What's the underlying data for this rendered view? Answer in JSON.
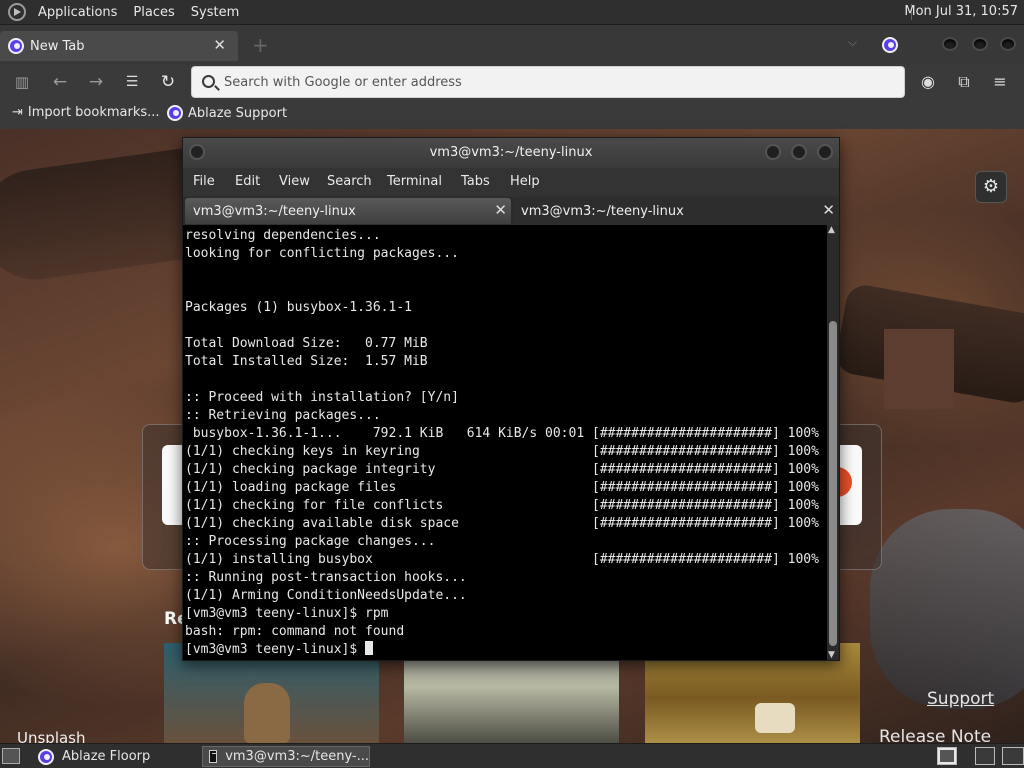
{
  "panel": {
    "menus": [
      "Applications",
      "Places",
      "System"
    ],
    "clock": "Mon Jul 31, 10:57"
  },
  "browser": {
    "tab": {
      "title": "New Tab",
      "close": "✕"
    },
    "urlbar": {
      "placeholder": "Search with Google or enter address"
    },
    "bookmarks": [
      {
        "label": "Import bookmarks...",
        "icon": "import-icon"
      },
      {
        "label": "Ablaze Support",
        "icon": "floorp-icon"
      }
    ]
  },
  "newtab": {
    "recommended_heading": "Re",
    "links": {
      "unsplash": "Unsplash",
      "support": "Support",
      "release": "Release Note"
    }
  },
  "terminal": {
    "title": "vm3@vm3:~/teeny-linux",
    "menus": [
      "File",
      "Edit",
      "View",
      "Search",
      "Terminal",
      "Tabs",
      "Help"
    ],
    "tabs": [
      {
        "label": "vm3@vm3:~/teeny-linux",
        "active": true
      },
      {
        "label": "vm3@vm3:~/teeny-linux",
        "active": false
      }
    ],
    "lines": [
      "resolving dependencies...",
      "looking for conflicting packages...",
      "",
      "",
      "Packages (1) busybox-1.36.1-1",
      "",
      "Total Download Size:   0.77 MiB",
      "Total Installed Size:  1.57 MiB",
      "",
      ":: Proceed with installation? [Y/n]",
      ":: Retrieving packages...",
      " busybox-1.36.1-1...    792.1 KiB   614 KiB/s 00:01 [######################] 100%",
      "(1/1) checking keys in keyring                      [######################] 100%",
      "(1/1) checking package integrity                    [######################] 100%",
      "(1/1) loading package files                         [######################] 100%",
      "(1/1) checking for file conflicts                   [######################] 100%",
      "(1/1) checking available disk space                 [######################] 100%",
      ":: Processing package changes...",
      "(1/1) installing busybox                            [######################] 100%",
      ":: Running post-transaction hooks...",
      "(1/1) Arming ConditionNeedsUpdate...",
      "[vm3@vm3 teeny-linux]$ rpm",
      "bash: rpm: command not found",
      "[vm3@vm3 teeny-linux]$ "
    ]
  },
  "taskbar": {
    "tasks": [
      "Ablaze Floorp",
      "vm3@vm3:~/teeny-..."
    ]
  },
  "colors": {
    "floorp_accent": "#5c3ee6",
    "terminal_bg": "#000000",
    "panel_bg": "#2f2f2f"
  }
}
